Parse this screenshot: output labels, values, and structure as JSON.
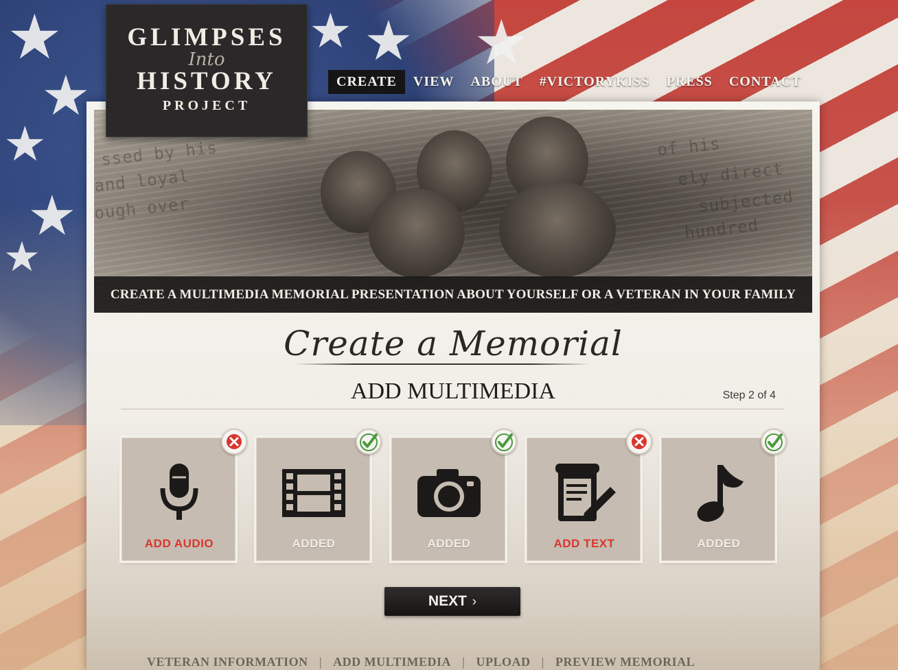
{
  "logo": {
    "line1": "GLIMPSES",
    "line2": "Into",
    "line3": "HISTORY",
    "line4": "PROJECT"
  },
  "nav": {
    "items": [
      {
        "label": "CREATE",
        "active": true
      },
      {
        "label": "VIEW",
        "active": false
      },
      {
        "label": "ABOUT",
        "active": false
      },
      {
        "label": "#VICTORYKISS",
        "active": false
      },
      {
        "label": "PRESS",
        "active": false
      },
      {
        "label": "CONTACT",
        "active": false
      }
    ]
  },
  "hero": {
    "caption": "CREATE A MULTIMEDIA MEMORIAL PRESENTATION ABOUT YOURSELF OR A VETERAN IN YOUR FAMILY"
  },
  "page": {
    "script_title": "Create a Memorial",
    "section_title": "ADD MULTIMEDIA",
    "step_label": "Step 2 of 4"
  },
  "media_cards": [
    {
      "icon": "microphone-icon",
      "label": "ADD AUDIO",
      "status": "missing"
    },
    {
      "icon": "film-strip-icon",
      "label": "ADDED",
      "status": "added"
    },
    {
      "icon": "camera-icon",
      "label": "ADDED",
      "status": "added"
    },
    {
      "icon": "document-edit-icon",
      "label": "ADD TEXT",
      "status": "missing"
    },
    {
      "icon": "music-note-icon",
      "label": "ADDED",
      "status": "added"
    }
  ],
  "next_button": {
    "label": "NEXT",
    "chevron": "›"
  },
  "bottom_steps": [
    "VETERAN INFORMATION",
    "ADD MULTIMEDIA",
    "UPLOAD",
    "PREVIEW MEMORIAL"
  ],
  "colors": {
    "added_label": "#f1ece6",
    "missing_label": "#d8372f",
    "check_green": "#4a9a3c",
    "cross_red": "#d8372f",
    "nav_active_bg": "#151515",
    "logo_bg": "#2a2828"
  }
}
